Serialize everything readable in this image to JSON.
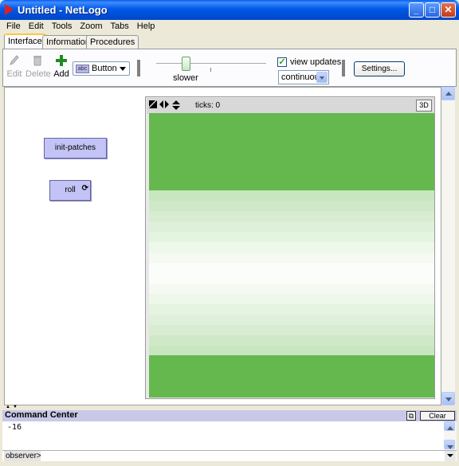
{
  "window": {
    "title": "Untitled - NetLogo",
    "minimize": "_",
    "maximize": "□",
    "close": "✕"
  },
  "menu": [
    "File",
    "Edit",
    "Tools",
    "Zoom",
    "Tabs",
    "Help"
  ],
  "tabs": [
    {
      "label": "Interface",
      "active": true
    },
    {
      "label": "Information",
      "active": false
    },
    {
      "label": "Procedures",
      "active": false
    }
  ],
  "toolbar": {
    "edit_label": "Edit",
    "delete_label": "Delete",
    "add_label": "Add",
    "widget_type": "Button",
    "widget_type_icon_text": "abc",
    "speed_label": "slower",
    "speed_value": 0.27,
    "view_updates_label": "view updates",
    "view_updates_checked": true,
    "update_mode": "continuous",
    "settings_label": "Settings..."
  },
  "widgets": {
    "init_patches_label": "init-patches",
    "roll_label": "roll",
    "roll_forever_icon": "forever-icon"
  },
  "view": {
    "ticks_label": "ticks: 0",
    "threed_label": "3D",
    "colors": {
      "green": "#65B84D",
      "white": "#FFFFFF"
    }
  },
  "command_center": {
    "title": "Command Center",
    "clear_label": "Clear",
    "output": "-16",
    "prompt": "observer>",
    "input_value": ""
  }
}
